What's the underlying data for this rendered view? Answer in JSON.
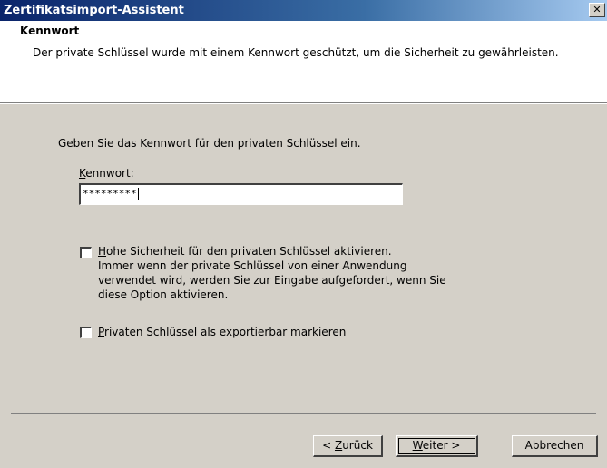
{
  "window": {
    "title": "Zertifikatsimport-Assistent",
    "close_glyph": "✕"
  },
  "header": {
    "title": "Kennwort",
    "description": "Der private Schlüssel wurde mit einem Kennwort geschützt, um die Sicherheit zu gewährleisten."
  },
  "body": {
    "intro": "Geben Sie das Kennwort für den privaten Schlüssel ein.",
    "password_label_accel": "K",
    "password_label_rest": "ennwort:",
    "password_value": "*********",
    "high_security": {
      "checked": false,
      "accel": "H",
      "label_rest": "ohe Sicherheit für den privaten Schlüssel aktivieren.",
      "description": "Immer wenn der private Schlüssel von einer Anwendung verwendet wird, werden Sie zur Eingabe aufgefordert, wenn Sie diese Option aktivieren."
    },
    "exportable": {
      "checked": false,
      "accel": "P",
      "label_rest": "rivaten Schlüssel als exportierbar markieren"
    }
  },
  "buttons": {
    "back_prefix": "< ",
    "back_accel": "Z",
    "back_rest": "urück",
    "next_accel": "W",
    "next_rest": "eiter >",
    "cancel": "Abbrechen"
  }
}
